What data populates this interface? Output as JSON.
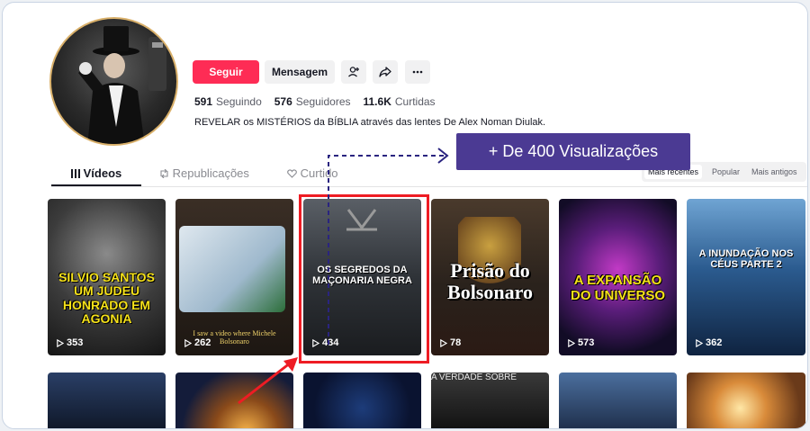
{
  "profile": {
    "follow_label": "Seguir",
    "message_label": "Mensagem",
    "stats": [
      {
        "value": "591",
        "label": "Seguindo"
      },
      {
        "value": "576",
        "label": "Seguidores"
      },
      {
        "value": "11.6K",
        "label": "Curtidas"
      }
    ],
    "bio": "REVELAR os MISTÉRIOS da BÍBLIA através das lentes De Alex Noman Diulak."
  },
  "tabs": [
    {
      "label": "Vídeos",
      "icon": "grid-icon"
    },
    {
      "label": "Republicações",
      "icon": "repost-icon"
    },
    {
      "label": "Curtido",
      "icon": "heart-icon"
    }
  ],
  "sort_options": [
    "Mais recentes",
    "Popular",
    "Mais antigos"
  ],
  "annotation": {
    "callout_text": "+ De 400 Visualizações"
  },
  "videos_row1": [
    {
      "title": "SILVIO SANTOS UM JUDEU HONRADO EM AGONIA",
      "views": "353"
    },
    {
      "title": "I saw a video where Michele Bolsonaro",
      "views": "262"
    },
    {
      "title": "OS SEGREDOS DA MAÇONARIA NEGRA",
      "views": "434"
    },
    {
      "title": "Prisão do Bolsonaro",
      "views": "78"
    },
    {
      "title": "A EXPANSÃO DO UNIVERSO",
      "views": "573"
    },
    {
      "title": "A INUNDAÇÃO NOS CÉUS PARTE 2",
      "views": "362"
    }
  ],
  "videos_row2": [
    {
      "title": ""
    },
    {
      "title": ""
    },
    {
      "title": ""
    },
    {
      "title": "A VERDADE SOBRE"
    },
    {
      "title": ""
    },
    {
      "title": ""
    }
  ],
  "colors": {
    "accent": "#fe2c55",
    "callout_bg": "#4b3a93",
    "highlight": "#ee1c24"
  }
}
